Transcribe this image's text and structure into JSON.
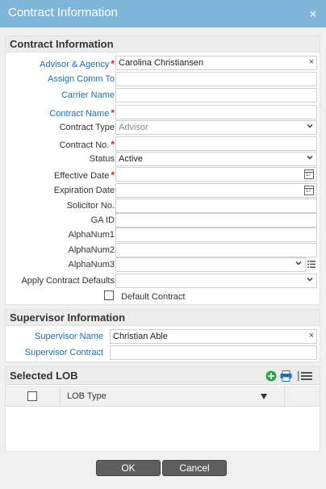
{
  "window": {
    "title": "Contract Information",
    "close": "×"
  },
  "contract": {
    "header": "Contract Information",
    "advisor_label": "Advisor & Agency",
    "advisor_value": "Carolina Christiansen",
    "advisor_clear": "×",
    "assign_comm_label": "Assign Comm To",
    "carrier_name_label": "Carrier Name",
    "contract_name_label": "Contract Name",
    "contract_type_label": "Contract Type",
    "contract_type_value": "Advisor",
    "contract_no_label": "Contract No.",
    "status_label": "Status",
    "status_value": "Active",
    "effective_date_label": "Effective Date",
    "expiration_date_label": "Expiration Date",
    "solicitor_label": "Solicitor No.",
    "ga_id_label": "GA ID",
    "alphanum1_label": "AlphaNum1",
    "alphanum2_label": "AlphaNum2",
    "alphanum3_label": "AlphaNum3",
    "apply_defaults_label": "Apply Contract Defaults",
    "default_contract_label": "Default Contract",
    "required_mark": "*",
    "cal_glyph": "17"
  },
  "supervisor": {
    "header": "Supervisor Information",
    "name_label": "Supervisor Name",
    "name_value": "Christian Able",
    "name_clear": "×",
    "contract_label": "Supervisor Contract"
  },
  "lob": {
    "header": "Selected LOB",
    "column_type": "LOB Type"
  },
  "buttons": {
    "ok": "OK",
    "cancel": "Cancel"
  },
  "colors": {
    "titlebar": "#7fb5d9",
    "link_label": "#1a6fb5",
    "required": "#d9202a",
    "add_icon": "#2aa64a",
    "print_icon": "#1a6fb5"
  }
}
